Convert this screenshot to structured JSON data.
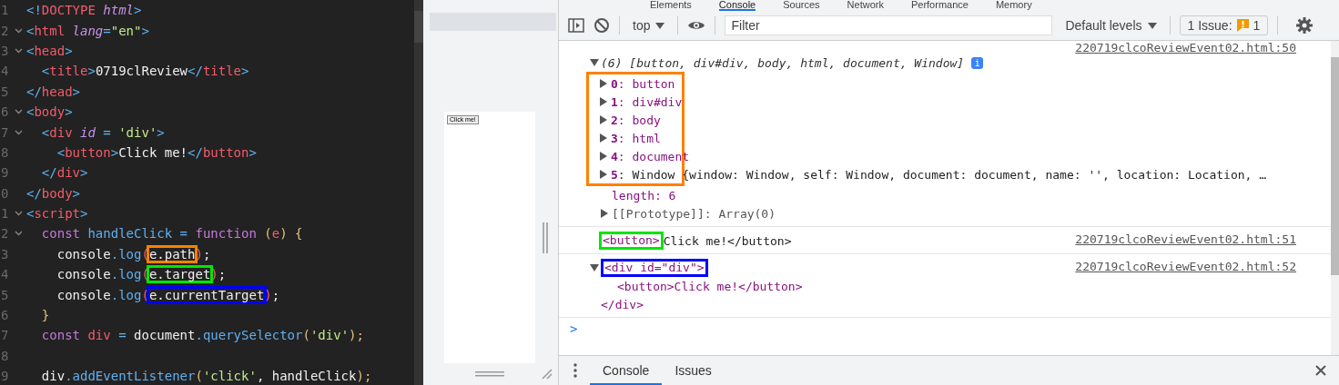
{
  "editor": {
    "lines": [
      {
        "number": "1",
        "foldable": false,
        "tokens": [
          {
            "text": "<!",
            "kind": "punct"
          },
          {
            "text": "DOCTYPE",
            "kind": "tag"
          },
          {
            "text": " html",
            "kind": "attr"
          },
          {
            "text": ">",
            "kind": "punct"
          }
        ]
      },
      {
        "number": "2",
        "foldable": true,
        "tokens": [
          {
            "text": "<",
            "kind": "punct"
          },
          {
            "text": "html",
            "kind": "tag"
          },
          {
            "text": " lang",
            "kind": "attr"
          },
          {
            "text": "=",
            "kind": "punct"
          },
          {
            "text": "\"en\"",
            "kind": "str"
          },
          {
            "text": ">",
            "kind": "punct"
          }
        ]
      },
      {
        "number": "3",
        "foldable": true,
        "tokens": [
          {
            "text": "<",
            "kind": "punct"
          },
          {
            "text": "head",
            "kind": "tag"
          },
          {
            "text": ">",
            "kind": "punct"
          }
        ]
      },
      {
        "number": "4",
        "foldable": false,
        "tokens": [
          {
            "text": "  <",
            "kind": "punct"
          },
          {
            "text": "title",
            "kind": "tag"
          },
          {
            "text": ">",
            "kind": "punct"
          },
          {
            "text": "0719clReview",
            "kind": "plain"
          },
          {
            "text": "</",
            "kind": "punct"
          },
          {
            "text": "title",
            "kind": "tag"
          },
          {
            "text": ">",
            "kind": "punct"
          }
        ]
      },
      {
        "number": "5",
        "foldable": false,
        "tokens": [
          {
            "text": "</",
            "kind": "punct"
          },
          {
            "text": "head",
            "kind": "tag"
          },
          {
            "text": ">",
            "kind": "punct"
          }
        ]
      },
      {
        "number": "6",
        "foldable": true,
        "tokens": [
          {
            "text": "<",
            "kind": "punct"
          },
          {
            "text": "body",
            "kind": "tag"
          },
          {
            "text": ">",
            "kind": "punct"
          }
        ]
      },
      {
        "number": "7",
        "foldable": true,
        "tokens": [
          {
            "text": "  <",
            "kind": "punct"
          },
          {
            "text": "div",
            "kind": "tag"
          },
          {
            "text": " id",
            "kind": "attr"
          },
          {
            "text": " = ",
            "kind": "punct"
          },
          {
            "text": "'div'",
            "kind": "str"
          },
          {
            "text": ">",
            "kind": "punct"
          }
        ]
      },
      {
        "number": "8",
        "foldable": false,
        "tokens": [
          {
            "text": "    <",
            "kind": "punct"
          },
          {
            "text": "button",
            "kind": "tag"
          },
          {
            "text": ">",
            "kind": "punct"
          },
          {
            "text": "Click me!",
            "kind": "plain"
          },
          {
            "text": "</",
            "kind": "punct"
          },
          {
            "text": "button",
            "kind": "tag"
          },
          {
            "text": ">",
            "kind": "punct"
          }
        ]
      },
      {
        "number": "9",
        "foldable": false,
        "tokens": [
          {
            "text": "  </",
            "kind": "punct"
          },
          {
            "text": "div",
            "kind": "tag"
          },
          {
            "text": ">",
            "kind": "punct"
          }
        ]
      },
      {
        "number": "0",
        "foldable": false,
        "tokens": [
          {
            "text": "</",
            "kind": "punct"
          },
          {
            "text": "body",
            "kind": "tag"
          },
          {
            "text": ">",
            "kind": "punct"
          }
        ]
      },
      {
        "number": "1",
        "foldable": true,
        "tokens": [
          {
            "text": "<",
            "kind": "punct"
          },
          {
            "text": "script",
            "kind": "tag"
          },
          {
            "text": ">",
            "kind": "punct"
          }
        ]
      },
      {
        "number": "2",
        "foldable": true,
        "tokens": [
          {
            "text": "  const",
            "kind": "keyword"
          },
          {
            "text": " handleClick",
            "kind": "fn"
          },
          {
            "text": " = ",
            "kind": "punct"
          },
          {
            "text": "function",
            "kind": "keyword"
          },
          {
            "text": " (",
            "kind": "paren"
          },
          {
            "text": "e",
            "kind": "var"
          },
          {
            "text": ") {",
            "kind": "paren"
          }
        ]
      },
      {
        "number": "3",
        "foldable": false,
        "tokens": [
          {
            "text": "    console",
            "kind": "plain"
          },
          {
            "text": ".",
            "kind": "punct"
          },
          {
            "text": "log",
            "kind": "fn"
          },
          {
            "text": "(",
            "kind": "var"
          },
          {
            "text": "e.path",
            "kind": "plain",
            "color": "#ff8000"
          },
          {
            "text": ")",
            "kind": "var"
          },
          {
            "text": ";",
            "kind": "plain"
          }
        ]
      },
      {
        "number": "4",
        "foldable": false,
        "tokens": [
          {
            "text": "    console",
            "kind": "plain"
          },
          {
            "text": ".",
            "kind": "punct"
          },
          {
            "text": "log",
            "kind": "fn"
          },
          {
            "text": "(",
            "kind": "var"
          },
          {
            "text": "e.target",
            "kind": "plain",
            "color": "#00e600"
          },
          {
            "text": ")",
            "kind": "var"
          },
          {
            "text": ";",
            "kind": "plain"
          }
        ]
      },
      {
        "number": "5",
        "foldable": false,
        "tokens": [
          {
            "text": "    console",
            "kind": "plain"
          },
          {
            "text": ".",
            "kind": "punct"
          },
          {
            "text": "log",
            "kind": "fn"
          },
          {
            "text": "(",
            "kind": "var"
          },
          {
            "text": "e.currentTarget",
            "kind": "plain",
            "color": "#0000ff"
          },
          {
            "text": ")",
            "kind": "var"
          },
          {
            "text": ";",
            "kind": "plain"
          }
        ]
      },
      {
        "number": "6",
        "foldable": false,
        "tokens": [
          {
            "text": "  }",
            "kind": "paren"
          }
        ]
      },
      {
        "number": "7",
        "foldable": false,
        "tokens": [
          {
            "text": "  const",
            "kind": "keyword"
          },
          {
            "text": " div",
            "kind": "var"
          },
          {
            "text": " = ",
            "kind": "punct"
          },
          {
            "text": "document",
            "kind": "plain"
          },
          {
            "text": ".",
            "kind": "punct"
          },
          {
            "text": "querySelector",
            "kind": "fn"
          },
          {
            "text": "(",
            "kind": "paren"
          },
          {
            "text": "'div'",
            "kind": "str"
          },
          {
            "text": ");",
            "kind": "paren"
          }
        ]
      },
      {
        "number": "8",
        "foldable": false
      },
      {
        "number": "9",
        "foldable": false,
        "tokens": [
          {
            "text": "  div",
            "kind": "plain"
          },
          {
            "text": ".addEventListener",
            "kind": "fn"
          },
          {
            "text": "(",
            "kind": "paren"
          },
          {
            "text": "'click'",
            "kind": "str"
          },
          {
            "text": ", handleClick",
            "kind": "plain"
          },
          {
            "text": ");",
            "kind": "paren"
          }
        ]
      }
    ]
  },
  "preview": {
    "button_label": "Click me!"
  },
  "devtools": {
    "tabs": [
      {
        "label": "Elements",
        "selected": false
      },
      {
        "label": "Console",
        "selected": true
      },
      {
        "label": "Sources",
        "selected": false
      },
      {
        "label": "Network",
        "selected": false
      },
      {
        "label": "Performance",
        "selected": false
      },
      {
        "label": "Memory",
        "selected": false
      }
    ],
    "toolbar": {
      "context": "top",
      "filter_placeholder": "Filter",
      "levels": "Default levels",
      "issues_label": "1 Issue:",
      "issues_count": "1"
    },
    "messages": [
      {
        "kind": "array",
        "source": "220719clcoReviewEvent02.html:50",
        "expanded": true,
        "summary": "(6) [button, div#div, body, html, document, Window]",
        "info_badge": "i",
        "color": "#ff8000",
        "entries": [
          {
            "text": "**0**: button",
            "kind": "node"
          },
          {
            "text": "**1**: div#div",
            "kind": "node"
          },
          {
            "text": "**2**: body",
            "kind": "node"
          },
          {
            "text": "**3**: html",
            "kind": "node"
          },
          {
            "text": "**4**: document",
            "kind": "node"
          },
          {
            "text": "**5**: Window {window: Window, self: Window, document: document, name: '', location: Location, …",
            "kind": "object"
          }
        ],
        "extra": [
          {
            "text": "length: 6",
            "kind": "plain"
          },
          {
            "text": "[[Prototype]]: Array(0)",
            "kind": "expandable"
          }
        ]
      },
      {
        "kind": "element",
        "source": "220719clcoReviewEvent02.html:51",
        "open": "<button>",
        "text": "Click me!</button>",
        "color": "#00e600"
      },
      {
        "kind": "tree",
        "source": "220719clcoReviewEvent02.html:52",
        "expanded": true,
        "open": "<div id=\"div\">",
        "color": "#0000ff",
        "children": [
          "<button>Click me!</button>"
        ],
        "close": "</div>"
      }
    ],
    "prompt": ">",
    "drawer_tabs": [
      {
        "label": "Console",
        "selected": true
      },
      {
        "label": "Issues",
        "selected": false
      }
    ]
  }
}
